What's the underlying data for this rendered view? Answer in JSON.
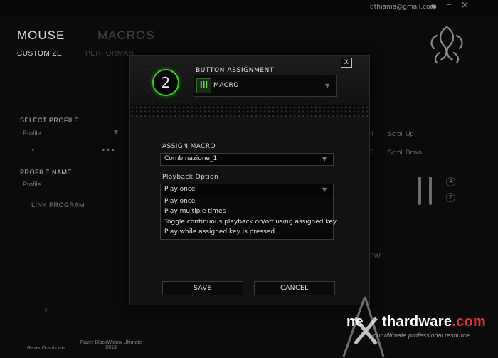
{
  "topbar": {
    "email": "dthiama@gmail.com",
    "icons": [
      "eye-icon",
      "minimize-icon",
      "close-icon"
    ]
  },
  "background": {
    "nav": {
      "mouse": "MOUSE",
      "macros": "MACROS",
      "customize": "CUSTOMIZE",
      "performance": "PERFORMAN"
    },
    "select_profile_label": "SELECT PROFILE",
    "profile_value": "Profile",
    "profile_name_label": "PROFILE NAME",
    "profile_name_value": "Profile",
    "link_program": "LINK PROGRAM",
    "scroll_up": "Scroll Up",
    "scroll_down": "Scroll Down",
    "badge_4a": "4",
    "badge_5a": "5",
    "badge_4b": "4",
    "badge_7": "7",
    "partial_w": "EW",
    "device_1": "Razer Ouroboros",
    "device_2_line1": "Razer BlackWidow Ultimate",
    "device_2_line2": "2013"
  },
  "dialog": {
    "close_label": "X",
    "button_number": "2",
    "button_assignment_title": "BUTTON ASSIGNMENT",
    "assignment_icon": "macro-icon",
    "assignment_value": "MACRO",
    "assign_macro_label": "ASSIGN MACRO",
    "assign_macro_value": "Combinazione_1",
    "playback_label": "Playback Option",
    "playback_value": "Play once",
    "playback_options": [
      "Play once",
      "Play multiple times",
      "Toggle continuous playback on/off using assigned key",
      "Play while assigned key is pressed"
    ],
    "save_label": "SAVE",
    "cancel_label": "CANCEL"
  },
  "watermark": {
    "brand_a": "ne",
    "brand_b": "thardware",
    "brand_c": ".com",
    "tagline": "your ultimate professional resource"
  },
  "colors": {
    "accent_green": "#33d11f",
    "background": "#0b0b0b"
  }
}
